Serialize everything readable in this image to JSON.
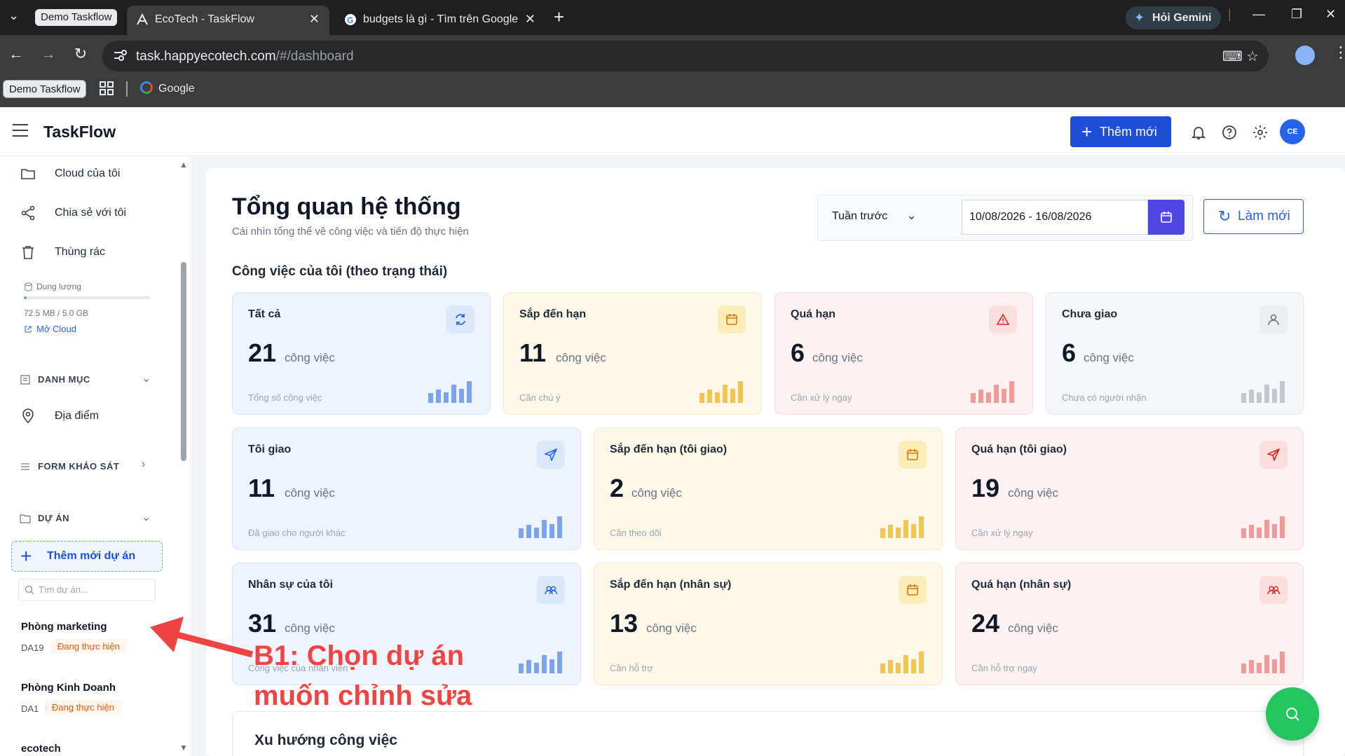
{
  "browser": {
    "tab_group_label": "Demo Taskflow",
    "tabs": [
      {
        "title": "EcoTech - TaskFlow",
        "active": true
      },
      {
        "title": "budgets là gì - Tìm trên Google",
        "active": false
      }
    ],
    "gemini_label": "Hỏi Gemini",
    "url_host": "task.happyecotech.com",
    "url_path": "/#/dashboard",
    "bookmarks": {
      "group_label": "Demo Taskflow",
      "google_label": "Google"
    }
  },
  "header": {
    "brand": "TaskFlow",
    "add_button": "Thêm mới",
    "avatar_initials": "CE"
  },
  "sidebar": {
    "items": [
      {
        "label": "Cloud của tôi",
        "icon": "folder-icon"
      },
      {
        "label": "Chia sẻ với tôi",
        "icon": "share-icon"
      },
      {
        "label": "Thùng rác",
        "icon": "trash-icon"
      }
    ],
    "storage": {
      "label": "Dung lượng",
      "value": "72.5 MB / 5.0 GB",
      "fraction": 0.014,
      "open_link": "Mở Cloud"
    },
    "sections": {
      "categories": "DANH MỤC",
      "location": "Địa điểm",
      "survey": "FORM KHẢO SÁT",
      "projects": "DỰ ÁN"
    },
    "new_project": "Thêm mới dự án",
    "project_search_placeholder": "Tìm dự án...",
    "projects": [
      {
        "name": "Phòng marketing",
        "code": "DA19",
        "status": "Đang thực hiện"
      },
      {
        "name": "Phòng Kinh Doanh",
        "code": "DA1",
        "status": "Đang thực hiện"
      },
      {
        "name": "ecotech"
      }
    ]
  },
  "main": {
    "title": "Tổng quan hệ thống",
    "subtitle": "Cái nhìn tổng thể về công việc và tiến độ thực hiện",
    "period_select": "Tuần trước",
    "date_range": "10/08/2026 - 16/08/2026",
    "refresh_label": "Làm mới",
    "section_title": "Công việc của tôi (theo trạng thái)",
    "unit": "công việc",
    "cards": [
      {
        "title": "Tất cả",
        "value": "21",
        "sub": "Tổng số công việc",
        "icon": "refresh-icon"
      },
      {
        "title": "Sắp đến hạn",
        "value": "11",
        "sub": "Cần chú ý",
        "icon": "calendar-icon"
      },
      {
        "title": "Quá hạn",
        "value": "6",
        "sub": "Cần xử lý ngay",
        "icon": "warning-icon"
      },
      {
        "title": "Chưa giao",
        "value": "6",
        "sub": "Chưa có người nhận",
        "icon": "user-icon"
      },
      {
        "title": "Tôi giao",
        "value": "11",
        "sub": "Đã giao cho người khác",
        "icon": "send-icon"
      },
      {
        "title": "Sắp đến hạn (tôi giao)",
        "value": "2",
        "sub": "Cần theo dõi",
        "icon": "calendar-icon"
      },
      {
        "title": "Quá hạn (tôi giao)",
        "value": "19",
        "sub": "Cần xử lý ngay",
        "icon": "send-icon"
      },
      {
        "title": "Nhân sự của tôi",
        "value": "31",
        "sub": "Công việc của nhân viên",
        "icon": "users-icon"
      },
      {
        "title": "Sắp đến hạn (nhân sự)",
        "value": "13",
        "sub": "Cần hỗ trợ",
        "icon": "calendar-icon"
      },
      {
        "title": "Quá hạn (nhân sự)",
        "value": "24",
        "sub": "Cần hỗ trợ ngay",
        "icon": "users-icon"
      }
    ],
    "trend_title": "Xu hướng công việc"
  },
  "annotation": {
    "line1": "B1: Chọn dự án",
    "line2": "muốn chỉnh sửa"
  },
  "colors": {
    "primary": "#1d4ed8",
    "accent_indigo": "#4f46e5",
    "status_orange": "#ea580c",
    "annotation_red": "#ef4444",
    "fab_green": "#22c55e"
  }
}
